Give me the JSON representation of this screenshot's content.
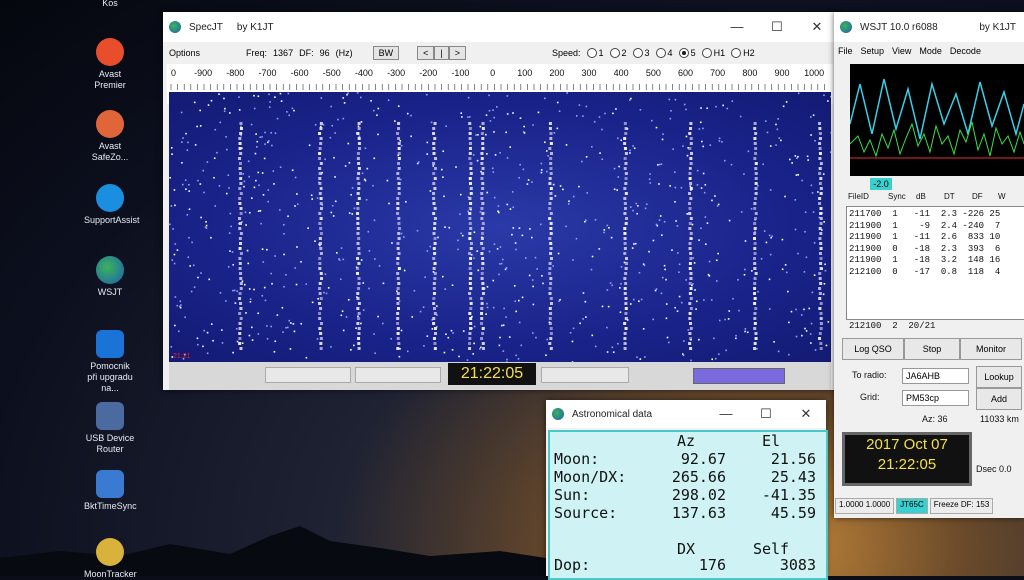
{
  "desktop": {
    "top_label": "Kos",
    "icons": [
      {
        "label": "Avast Premier",
        "color": "#e84e2b",
        "icon": "avast-icon"
      },
      {
        "label": "Avast SafeZo...",
        "color": "#e0663a",
        "icon": "safezone-icon"
      },
      {
        "label": "SupportAssist",
        "color": "#1a8fe0",
        "icon": "support-assist-icon"
      },
      {
        "label": "WSJT",
        "color": "#2a8a4a",
        "icon": "wsjt-globe-icon"
      },
      {
        "label": "Pomocnik při upgradu na...",
        "color": "#1a74d8",
        "icon": "windows-icon"
      },
      {
        "label": "USB Device Router",
        "color": "#4a6aa0",
        "icon": "usb-router-icon"
      },
      {
        "label": "BktTimeSync",
        "color": "#3a7ad0",
        "icon": "timesync-icon"
      },
      {
        "label": "MoonTracker",
        "color": "#d8b23a",
        "icon": "moon-icon"
      }
    ]
  },
  "spec": {
    "title": "SpecJT",
    "author": "by K1JT",
    "options": "Options",
    "freq_label": "Freq:",
    "freq_value": "1367",
    "df_label": "DF:",
    "df_value": "96",
    "df_unit": "(Hz)",
    "bw_button": "BW",
    "nav_buttons": [
      "<",
      "|",
      ">"
    ],
    "speed_label": "Speed:",
    "speeds": [
      "1",
      "2",
      "3",
      "4",
      "5",
      "H1",
      "H2"
    ],
    "speed_selected": "5",
    "scale_labels": [
      "0",
      "-900",
      "-800",
      "-700",
      "-600",
      "-500",
      "-400",
      "-300",
      "-200",
      "-100",
      "0",
      "100",
      "200",
      "300",
      "400",
      "500",
      "600",
      "700",
      "800",
      "900",
      "1000"
    ],
    "wf_time": "21:21",
    "clock": "21:22:05"
  },
  "wsjt": {
    "title": "WSJT 10.0   r6088",
    "author": "by K1JT",
    "menu": [
      "File",
      "Setup",
      "View",
      "Mode",
      "Decode"
    ],
    "db_value": "-2.0",
    "columns": [
      "FileID",
      "Sync",
      "dB",
      "DT",
      "DF",
      "W"
    ],
    "rows": [
      "211700  1   -11  2.3 -226 25",
      "211900  1    -9  2.4 -240  7",
      "211900  1   -11  2.6  833 10",
      "211900  0   -18  2.3  393  6",
      "211900  1   -18  3.2  148 16",
      "212100  0   -17  0.8  118  4"
    ],
    "footer": "212100  2  20/21",
    "log_qso": "Log QSO",
    "stop": "Stop",
    "monitor": "Monitor",
    "to_radio_label": "To radio:",
    "to_radio_value": "JA6AHB",
    "lookup": "Lookup",
    "grid_label": "Grid:",
    "grid_value": "PM53cp",
    "add": "Add",
    "az": "Az: 36",
    "distance": "11033 km",
    "date": "2017 Oct 07",
    "time": "21:22:05",
    "dsec": "Dsec  0.0",
    "status": [
      "1.0000 1.0000",
      "JT65C",
      "Freeze DF: 153"
    ]
  },
  "astro": {
    "title": "Astronomical data",
    "head_az": "Az",
    "head_el": "El",
    "rows": [
      {
        "name": "Moon:",
        "az": "92.67",
        "el": "21.56"
      },
      {
        "name": "Moon/DX:",
        "az": "265.66",
        "el": "25.43"
      },
      {
        "name": "Sun:",
        "az": "298.02",
        "el": "-41.35"
      },
      {
        "name": "Source:",
        "az": "137.63",
        "el": "45.59"
      }
    ],
    "head_dx": "DX",
    "head_self": "Self",
    "dop_label": "Dop:",
    "dop_dx": "176",
    "dop_self": "3083"
  },
  "colors": {
    "clock_bg": "#111111",
    "clock_fg": "#f4e04a",
    "waterfall": "#1a238a",
    "astro_bg": "#cff3f4",
    "mode_badge": "#39d0d0"
  }
}
